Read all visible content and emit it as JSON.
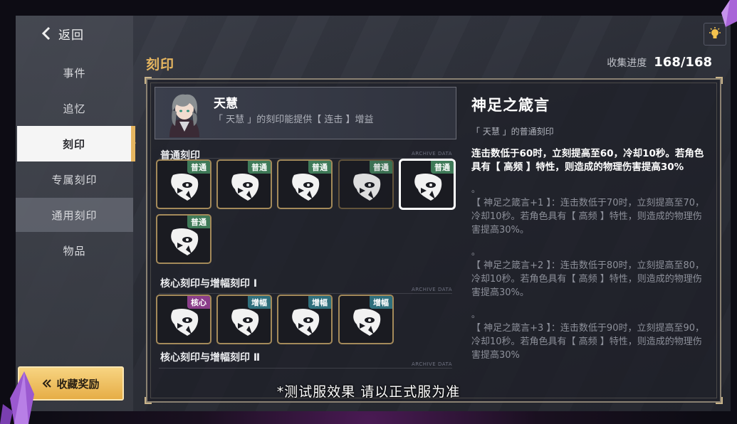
{
  "nav": {
    "back_label": "返回",
    "items": [
      {
        "label": "事件"
      },
      {
        "label": "追忆"
      },
      {
        "label": "刻印"
      },
      {
        "label": "专属刻印"
      },
      {
        "label": "通用刻印"
      },
      {
        "label": "物品"
      }
    ],
    "reward_button": "收藏奖励"
  },
  "header": {
    "title": "刻印",
    "progress_label": "收集进度",
    "progress_value": "168/168"
  },
  "character": {
    "name": "天慧",
    "description": "「 天慧 」的刻印能提供【 连击 】增益"
  },
  "sections": [
    {
      "label": "普通刻印",
      "archive": "ARCHIVE DATA",
      "cards": [
        {
          "tag": "普通",
          "kind": "normal"
        },
        {
          "tag": "普通",
          "kind": "normal"
        },
        {
          "tag": "普通",
          "kind": "normal"
        },
        {
          "tag": "普通",
          "kind": "normal"
        },
        {
          "tag": "普通",
          "kind": "normal"
        },
        {
          "tag": "普通",
          "kind": "normal"
        }
      ]
    },
    {
      "label": "核心刻印与增幅刻印 Ⅰ",
      "archive": "ARCHIVE DATA",
      "cards": [
        {
          "tag": "核心",
          "kind": "core"
        },
        {
          "tag": "增幅",
          "kind": "amp"
        },
        {
          "tag": "增幅",
          "kind": "amp"
        },
        {
          "tag": "增幅",
          "kind": "amp"
        }
      ]
    },
    {
      "label": "核心刻印与增幅刻印 Ⅱ",
      "archive": "ARCHIVE DATA"
    }
  ],
  "detail": {
    "title": "神足之箴言",
    "subtitle": "「 天慧 」的普通刻印",
    "description": "连击数低于60时，立刻提高至60，冷却10秒。若角色具有【 高频 】特性，则造成的物理伤害提高30%",
    "upgrades": [
      {
        "dot": "。",
        "text": "【 神足之箴言+1 】：连击数低于70时，立刻提高至70，冷却10秒。若角色具有【 高频 】特性，则造成的物理伤害提高30%。"
      },
      {
        "dot": "。",
        "text": "【 神足之箴言+2 】：连击数低于80时，立刻提高至80，冷却10秒。若角色具有【 高频 】特性，则造成的物理伤害提高30%。"
      },
      {
        "dot": "。",
        "text": "【 神足之箴言+3 】：连击数低于90时，立刻提高至90，冷却10秒。若角色具有【 高频 】特性，则造成的物理伤害提高30%"
      }
    ]
  },
  "subtitle": "*测试服效果 请以正式服为准",
  "colors": {
    "accent_gold": "#e6b660",
    "tag_normal": "#3f7a58",
    "tag_core": "#8b3e8a",
    "tag_amp": "#2f6f7c"
  }
}
